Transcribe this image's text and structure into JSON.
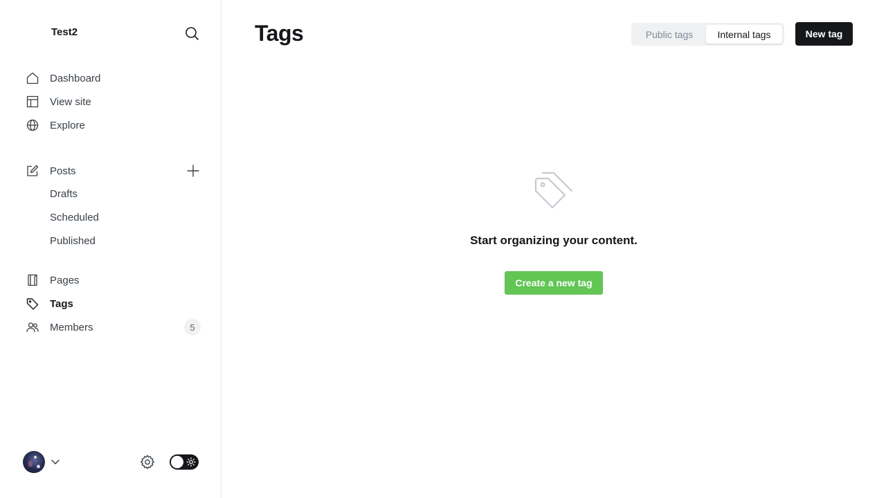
{
  "sidebar": {
    "site_title": "Test2",
    "nav": {
      "dashboard": "Dashboard",
      "view_site": "View site",
      "explore": "Explore",
      "posts": "Posts",
      "drafts": "Drafts",
      "scheduled": "Scheduled",
      "published": "Published",
      "pages": "Pages",
      "tags": "Tags",
      "members": "Members",
      "members_count": "5"
    },
    "active_item": "tags",
    "theme_toggle": "dark"
  },
  "main": {
    "title": "Tags",
    "filter": {
      "public": "Public tags",
      "internal": "Internal tags",
      "selected": "internal"
    },
    "new_tag_button": "New tag",
    "empty_state": {
      "message": "Start organizing your content.",
      "cta": "Create a new tag"
    }
  },
  "colors": {
    "accent_green": "#62c554",
    "primary_dark": "#15171a",
    "muted_text": "#7c8b9a"
  },
  "icons": {
    "search": "search-icon",
    "home": "home-icon",
    "view_site": "layout-icon",
    "explore": "globe-icon",
    "posts": "edit-icon",
    "add": "plus-icon",
    "pages": "page-icon",
    "tags": "tag-icon",
    "members": "users-icon",
    "settings": "gear-icon",
    "theme": "sun-icon"
  }
}
